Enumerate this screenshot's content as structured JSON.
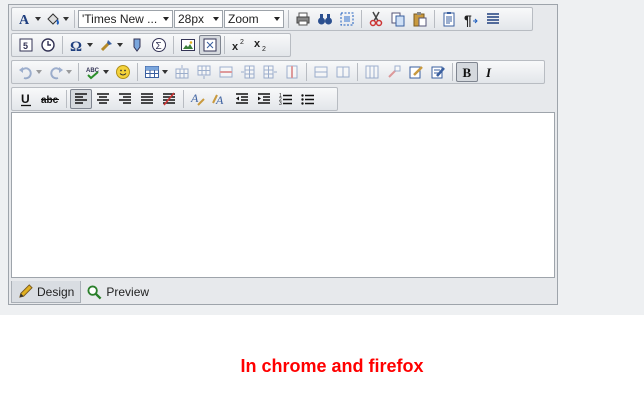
{
  "toolbars": {
    "font_name": "'Times New ...",
    "font_size": "28px",
    "zoom": "Zoom"
  },
  "tabs": {
    "design": "Design",
    "preview": "Preview"
  },
  "caption": "In chrome and firefox",
  "colors": {
    "caption": "#ff0000",
    "accent": "#1f5fbf"
  }
}
